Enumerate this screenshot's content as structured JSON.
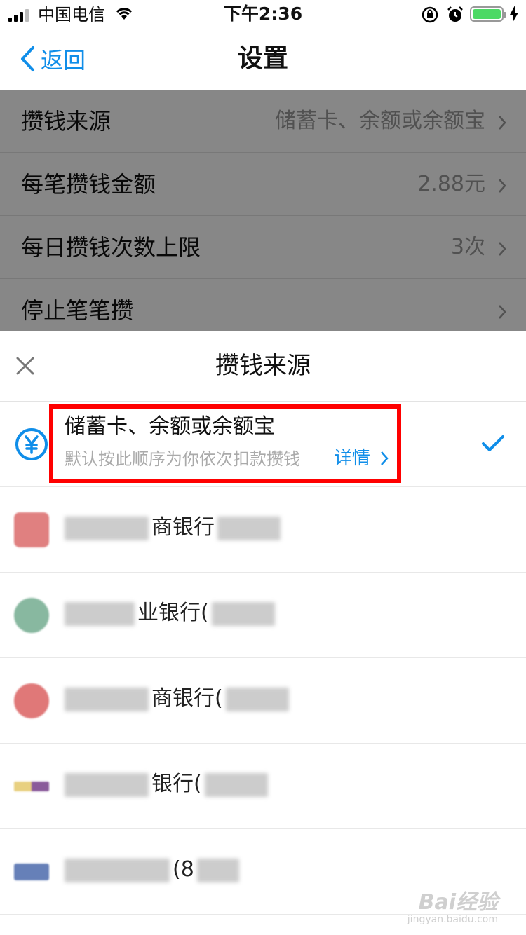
{
  "status_bar": {
    "carrier": "中国电信",
    "time": "下午2:36"
  },
  "nav": {
    "back_label": "返回",
    "title": "设置"
  },
  "settings": [
    {
      "label": "攒钱来源",
      "value": "储蓄卡、余额或余额宝"
    },
    {
      "label": "每笔攒钱金额",
      "value": "2.88元"
    },
    {
      "label": "每日攒钱次数上限",
      "value": "3次"
    },
    {
      "label": "停止笔笔攒",
      "value": ""
    }
  ],
  "sheet": {
    "title": "攒钱来源",
    "default_option": {
      "title": "储蓄卡、余额或余额宝",
      "subtitle": "默认按此顺序为你依次扣款攒钱",
      "detail_label": "详情",
      "selected": true
    },
    "banks": [
      {
        "name_visible": "商银行"
      },
      {
        "name_visible": "业银行("
      },
      {
        "name_visible": "商银行("
      },
      {
        "name_visible": "银行("
      },
      {
        "name_visible": "(8"
      }
    ]
  },
  "watermark": {
    "logo": "Bai经验",
    "url": "jingyan.baidu.com"
  },
  "colors": {
    "accent": "#108ee9",
    "highlight": "#ff0000",
    "battery": "#4cd964"
  }
}
